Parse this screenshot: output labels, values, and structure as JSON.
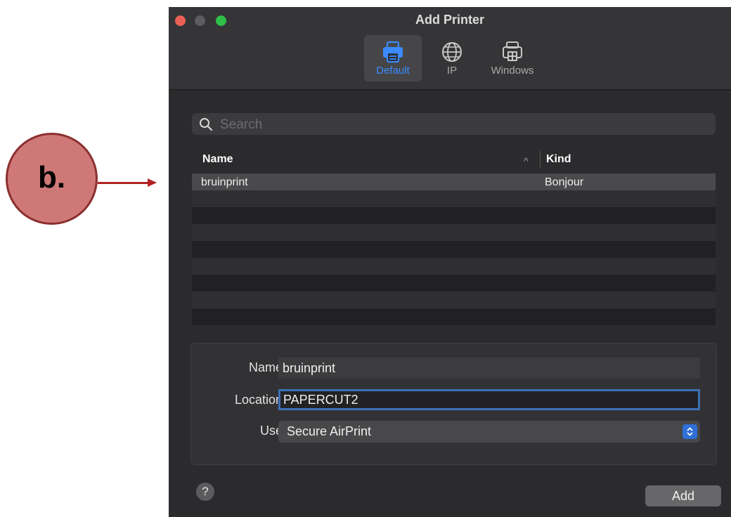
{
  "annotation": {
    "label": "b."
  },
  "window": {
    "title": "Add Printer",
    "tabs": [
      {
        "label": "Default",
        "icon": "printer-icon",
        "active": true
      },
      {
        "label": "IP",
        "icon": "globe-icon",
        "active": false
      },
      {
        "label": "Windows",
        "icon": "windows-printer-icon",
        "active": false
      }
    ]
  },
  "search": {
    "placeholder": "Search",
    "value": ""
  },
  "table": {
    "columns": [
      "Name",
      "Kind"
    ],
    "sort_indicator": "^",
    "rows": [
      {
        "name": "bruinprint",
        "kind": "Bonjour",
        "selected": true
      }
    ]
  },
  "form": {
    "name_label": "Name:",
    "name_value": "bruinprint",
    "location_label": "Location:",
    "location_value": "PAPERCUT2",
    "use_label": "Use:",
    "use_value": "Secure AirPrint"
  },
  "footer": {
    "help": "?",
    "add_label": "Add"
  },
  "colors": {
    "accent": "#3b8bff",
    "close": "#ec5f57",
    "maximize": "#2fbf48",
    "annotation_fill": "#cf7878",
    "arrow": "#b22222"
  }
}
